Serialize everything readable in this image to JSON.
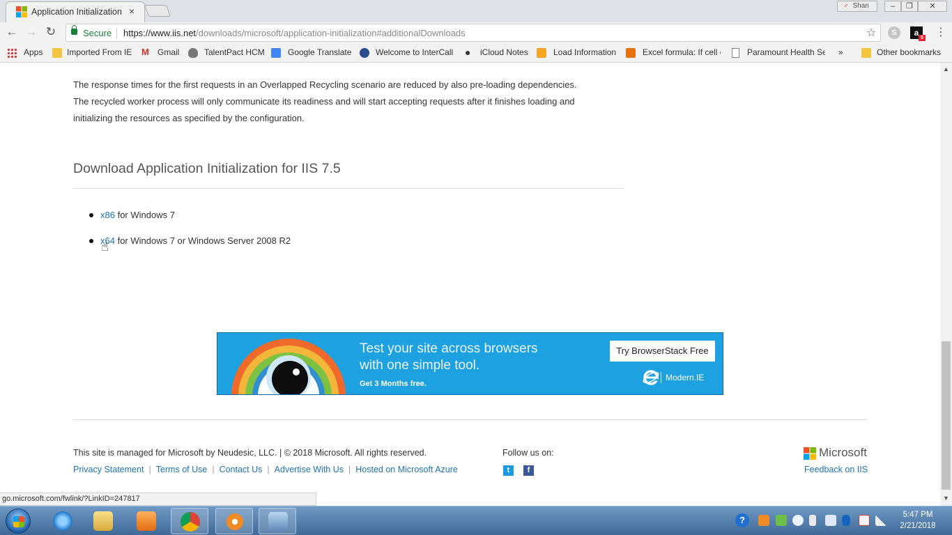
{
  "browser": {
    "tab_title": "Application Initialization",
    "tab_close": "×",
    "profile_name": "Shan",
    "window_min": "–",
    "window_restore": "❐",
    "window_close": "✕",
    "nav_back": "←",
    "nav_forward": "→",
    "nav_reload": "↻",
    "secure_label": "Secure",
    "url_scheme_host": "https://www.iis.net",
    "url_path": "/downloads/microsoft/application-initialization#additionalDownloads",
    "star": "☆",
    "menu": "⋮",
    "skype_label": "S",
    "amazon_label": "a",
    "amazon_badge": "5"
  },
  "bookmarks": {
    "items": [
      {
        "label": "Apps"
      },
      {
        "label": "Imported From IE"
      },
      {
        "label": "Gmail"
      },
      {
        "label": "TalentPact HCM"
      },
      {
        "label": "Google Translate"
      },
      {
        "label": "Welcome to InterCall"
      },
      {
        "label": "iCloud Notes"
      },
      {
        "label": "Load Information"
      },
      {
        "label": "Excel formula: If cell c"
      },
      {
        "label": "Paramount Health Se"
      }
    ],
    "overflow": "»",
    "other": "Other bookmarks"
  },
  "content": {
    "intro_line1": "The response times for the first requests in an Overlapped Recycling scenario are reduced by also pre-loading dependencies.",
    "intro_line2": "The recycled worker process will only communicate its readiness and will start accepting requests after it finishes loading and",
    "intro_line3": "initializing the resources as specified by the configuration.",
    "heading": "Download Application Initialization for IIS 7.5",
    "downloads": [
      {
        "link": "x86",
        "text": " for Windows 7"
      },
      {
        "link": "x64",
        "text": " for Windows 7 or Windows Server 2008 R2"
      }
    ]
  },
  "ad": {
    "line1": "Test your site across browsers",
    "line2": "with one simple tool.",
    "line3": "Get 3 Months free.",
    "button": "Try BrowserStack Free",
    "brand": "Modern.IE"
  },
  "footer": {
    "copyright": "This site is managed for Microsoft by Neudesic, LLC. | © 2018 Microsoft. All rights reserved.",
    "links": [
      "Privacy Statement",
      "Terms of Use",
      "Contact Us",
      "Advertise With Us",
      "Hosted on Microsoft Azure"
    ],
    "separator": "|",
    "follow": "Follow us on:",
    "twitter": "t",
    "facebook": "f",
    "ms_logo_text": "Microsoft",
    "feedback": "Feedback on IIS"
  },
  "status_url": "go.microsoft.com/fwlink/?LinkID=247817",
  "scrollbar": {
    "up": "▲",
    "down": "▼"
  },
  "taskbar": {
    "time": "5:47 PM",
    "date": "2/21/2018",
    "help_icon": "?"
  },
  "colors": {
    "link": "#1f73b7",
    "secure": "#188038",
    "ad_bg": "#1ea1e0"
  }
}
